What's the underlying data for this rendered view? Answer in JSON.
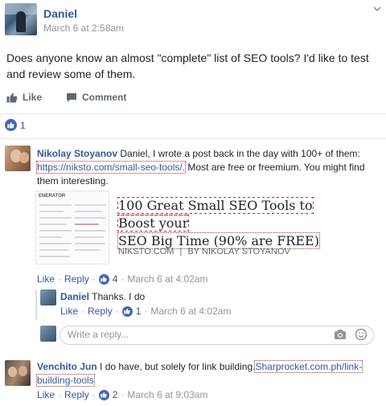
{
  "post": {
    "author": "Daniel",
    "time": "March 6 at 2:58am",
    "text": "Does anyone know an almost \"complete\" list of SEO tools? I'd like to test and review some of them."
  },
  "actions": {
    "like": "Like",
    "comment": "Comment"
  },
  "reactions": {
    "count": "1"
  },
  "comments": [
    {
      "author": "Nikolay Stoyanov",
      "text_before": " Daniel, I wrote a post back in the day with 100+ of them: ",
      "link": "https://niksto.com/small-seo-tools/.",
      "text_after": " Most are free or freemium. You might find them interesting.",
      "preview": {
        "thumb_header": "ENERATOR",
        "title_line1": "100 Great Small SEO Tools to Boost your",
        "title_line2": "SEO Big Time (90% are FREE)",
        "domain": "NIKSTO.COM",
        "separator": "|",
        "byline": "BY NIKOLAY STOYANOV"
      },
      "meta": {
        "like": "Like",
        "dot1": "·",
        "reply": "Reply",
        "dot2": "·",
        "reactions": "4",
        "dot3": "·",
        "time": "March 6 at 4:02am"
      }
    },
    {
      "author": "Venchito Jun",
      "text_before": " I do have, but solely for link building.",
      "link": "Sharprocket.com.ph/link-building-tools",
      "link_line1": "Sharprocket.com.ph/link-",
      "link_line2": "building-tools",
      "meta": {
        "like": "Like",
        "dot1": "·",
        "reply": "Reply",
        "dot2": "·",
        "reactions": "2",
        "dot3": "·",
        "time": "March 6 at 9:03am"
      }
    }
  ],
  "reply": {
    "author": "Daniel",
    "text": " Thanks. I do",
    "meta": {
      "like": "Like",
      "dot1": "·",
      "reply": "Reply",
      "dot2": "·",
      "reactions": "1",
      "dot3": "·",
      "time": "March 6 at 4:02am"
    }
  },
  "reply_input": {
    "placeholder": "Write a reply..."
  },
  "colors": {
    "link": "#365899",
    "like_blue": "#4267b2",
    "muted": "#90949c",
    "text": "#1d2129"
  }
}
